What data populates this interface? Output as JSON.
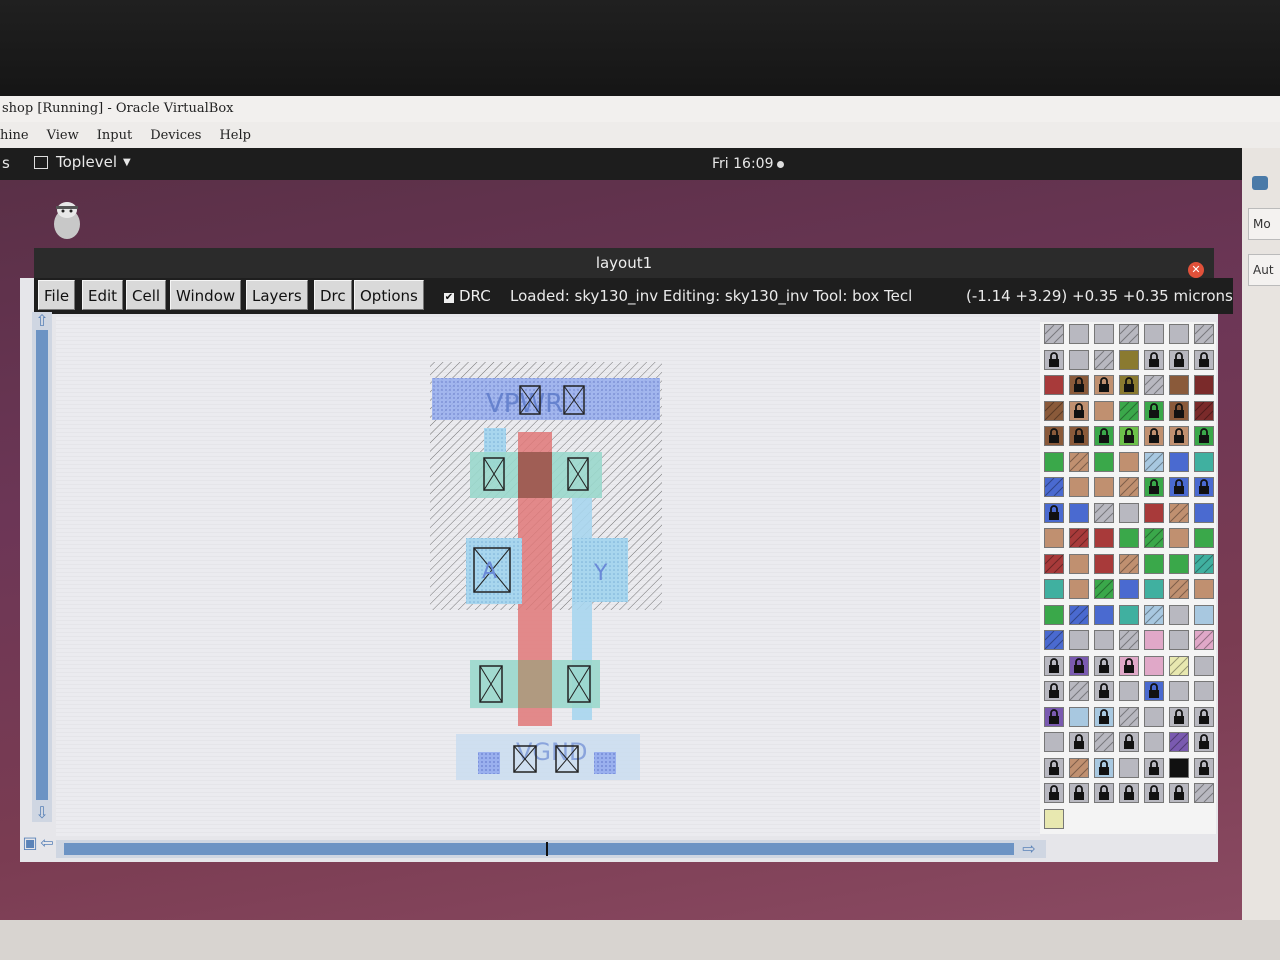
{
  "host": {
    "title": "shop [Running] - Oracle VirtualBox",
    "menu": [
      "hine",
      "View",
      "Input",
      "Devices",
      "Help"
    ]
  },
  "desktop": {
    "activities": "s",
    "toplevel": "Toplevel",
    "clock": "Fri 16:09",
    "side_buttons": [
      "Mo",
      "Aut"
    ]
  },
  "magic": {
    "window_title": "layout1",
    "menus": [
      "File",
      "Edit",
      "Cell",
      "Window",
      "Layers",
      "Drc",
      "Options"
    ],
    "drc_label": "DRC",
    "drc_checked": true,
    "status": "Loaded: sky130_inv Editing: sky130_inv Tool: box  Tecl",
    "coords": "(-1.14 +3.29) +0.35 +0.35 microns"
  },
  "layout": {
    "labels": [
      "VPWR",
      "A",
      "Y",
      "VGND"
    ]
  },
  "palette": {
    "colors": {
      "red": "#a83a3a",
      "green": "#3aa84a",
      "blue": "#4a6ad0",
      "brown": "#8a5a3a",
      "tan": "#c09070",
      "lightblue": "#a8c8e0",
      "gray": "#b8b8c0",
      "pink": "#e0a8c8",
      "olive": "#8a7a30",
      "purple": "#7a5ab0",
      "black": "#111111",
      "yellow": "#e8e8b0",
      "teal": "#40b0a0",
      "darkred": "#7a2a2a",
      "lime": "#6cc04a"
    }
  }
}
